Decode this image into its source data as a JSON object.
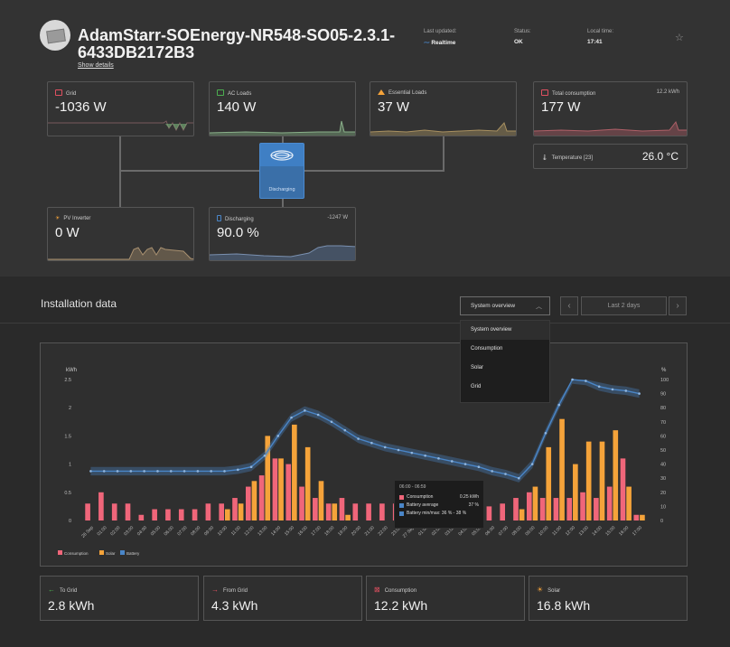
{
  "header": {
    "title": "AdamStarr-SOEnergy-NR548-SO05-2.3.1-6433DB2172B3",
    "show_details": "Show details",
    "last_updated_label": "Last updated:",
    "last_updated_value": "Realtime",
    "status_label": "Status:",
    "status_value": "OK",
    "local_time_label": "Local time:",
    "local_time_value": "17:41"
  },
  "overview": {
    "grid": {
      "label": "Grid",
      "value": "-1036 W"
    },
    "ac_loads": {
      "label": "AC Loads",
      "value": "140 W"
    },
    "essential_loads": {
      "label": "Essential Loads",
      "value": "37 W"
    },
    "total_consumption": {
      "label": "Total consumption",
      "value": "177 W",
      "extra": "12.2 kWh"
    },
    "temperature": {
      "label": "Temperature [23]",
      "value": "26.0 °C"
    },
    "pv_inverter": {
      "label": "PV Inverter",
      "value": "0 W"
    },
    "battery": {
      "label": "Discharging",
      "value": "90.0 %",
      "extra": "-1247 W"
    },
    "inverter": {
      "status": "Discharging"
    }
  },
  "installation": {
    "title": "Installation data",
    "selected_view": "System overview",
    "period": "Last 2 days",
    "options": [
      "System overview",
      "Consumption",
      "Solar",
      "Grid"
    ]
  },
  "colors": {
    "consumption": "#f0667a",
    "solar": "#f5a33a",
    "battery": "#4a86c8",
    "grid_icon": "#e05060",
    "ac_loads_icon": "#4caf50",
    "essential_icon": "#f5a33a",
    "total_icon": "#e05060",
    "battery_icon": "#4a86c8"
  },
  "chart_data": {
    "type": "bar",
    "left_axis_label": "kWh",
    "right_axis_label": "%",
    "ylim_left": [
      0,
      2.5
    ],
    "ylim_right": [
      0,
      100
    ],
    "left_ticks": [
      "0",
      "0.5",
      "1",
      "1.5",
      "2",
      "2.5"
    ],
    "right_ticks": [
      "0",
      "10",
      "20",
      "30",
      "40",
      "50",
      "60",
      "70",
      "80",
      "90",
      "100"
    ],
    "categories": [
      "26 Sep",
      "01:00",
      "02:00",
      "03:00",
      "04:00",
      "05:00",
      "06:00",
      "07:00",
      "08:00",
      "09:00",
      "10:00",
      "11:00",
      "12:00",
      "13:00",
      "14:00",
      "15:00",
      "16:00",
      "17:00",
      "18:00",
      "19:00",
      "20:00",
      "21:00",
      "22:00",
      "23:00",
      "27 Sep",
      "01:00",
      "02:00",
      "03:00",
      "04:00",
      "05:00",
      "06:00",
      "07:00",
      "08:00",
      "09:00",
      "10:00",
      "11:00",
      "12:00",
      "13:00",
      "14:00",
      "15:00",
      "16:00",
      "17:00"
    ],
    "series": [
      {
        "name": "Consumption",
        "values": [
          0.3,
          0.5,
          0.3,
          0.3,
          0.1,
          0.2,
          0.2,
          0.2,
          0.2,
          0.3,
          0.3,
          0.4,
          0.6,
          0.8,
          1.1,
          1.0,
          0.6,
          0.4,
          0.3,
          0.4,
          0.3,
          0.3,
          0.3,
          0.3,
          0.25,
          0.25,
          0.25,
          0.25,
          0.25,
          0.25,
          0.25,
          0.3,
          0.4,
          0.5,
          0.4,
          0.4,
          0.4,
          0.5,
          0.4,
          0.6,
          1.1,
          0.1
        ]
      },
      {
        "name": "Solar",
        "values": [
          0,
          0,
          0,
          0,
          0,
          0,
          0,
          0,
          0,
          0,
          0.2,
          0.3,
          0.7,
          1.5,
          1.1,
          1.7,
          1.3,
          0.7,
          0.3,
          0.1,
          0,
          0,
          0,
          0,
          0,
          0,
          0,
          0,
          0,
          0,
          0,
          0,
          0.2,
          0.6,
          1.3,
          1.8,
          1.0,
          1.4,
          1.4,
          1.6,
          0.6,
          0.1
        ]
      },
      {
        "name": "Battery",
        "values": [
          35,
          35,
          35,
          35,
          35,
          35,
          35,
          35,
          35,
          35,
          35,
          36,
          38,
          46,
          60,
          73,
          78,
          75,
          70,
          64,
          58,
          55,
          52,
          50,
          48,
          46,
          44,
          42,
          40,
          38,
          35,
          33,
          30,
          40,
          62,
          82,
          100,
          99,
          95,
          93,
          92,
          90
        ]
      }
    ],
    "legend": [
      "Consumption",
      "Solar",
      "Battery"
    ],
    "tooltip": {
      "time": "06:00 - 06:59",
      "rows": [
        {
          "name": "Consumption",
          "value": "0.25 kWh"
        },
        {
          "name": "Battery average",
          "value": "37 %"
        },
        {
          "name": "Battery min/max: 36 % - 38 %",
          "value": ""
        }
      ]
    }
  },
  "totals": {
    "to_grid": {
      "label": "To Grid",
      "value": "2.8 kWh"
    },
    "from_grid": {
      "label": "From Grid",
      "value": "4.3 kWh"
    },
    "consumption": {
      "label": "Consumption",
      "value": "12.2 kWh"
    },
    "solar": {
      "label": "Solar",
      "value": "16.8 kWh"
    }
  }
}
